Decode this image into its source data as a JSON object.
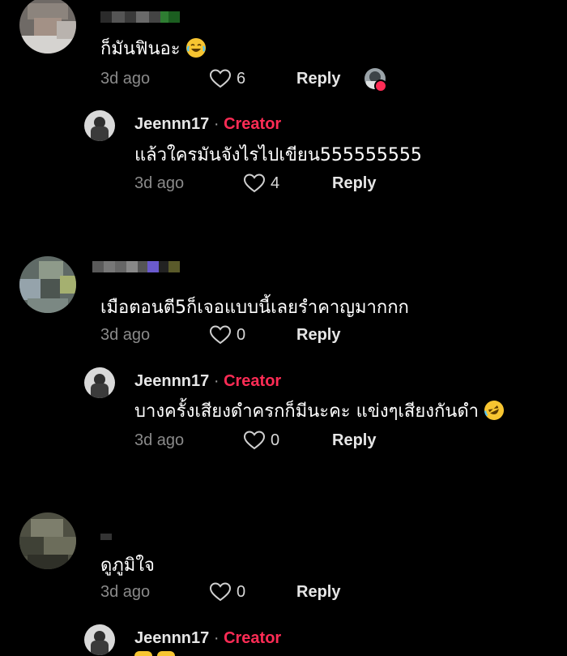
{
  "comments": [
    {
      "text": "ก็มันฟินอะ",
      "emoji_icon": "tears-of-joy-emoji",
      "time": "3d ago",
      "likes": "6",
      "reply_label": "Reply",
      "creator_liked": true,
      "reply": {
        "author": "Jeennn17",
        "separator": "·",
        "tag": "Creator",
        "text": "แล้วใครมันจังไรไปเขียน555555555",
        "time": "3d ago",
        "likes": "4",
        "reply_label": "Reply"
      }
    },
    {
      "text": "เมือตอนตี5ก็เจอแบบนี้เลยรำคาญมากกก",
      "time": "3d ago",
      "likes": "0",
      "reply_label": "Reply",
      "reply": {
        "author": "Jeennn17",
        "separator": "·",
        "tag": "Creator",
        "text": "บางครั้งเสียงดำครกก็มีนะคะ แข่งๆเสียงกันดำ",
        "emoji_icon": "rolling-laughing-emoji",
        "time": "3d ago",
        "likes": "0",
        "reply_label": "Reply"
      }
    },
    {
      "text": "ดูภูมิใจ",
      "time": "3d ago",
      "likes": "0",
      "reply_label": "Reply",
      "reply": {
        "author": "Jeennn17",
        "separator": "·",
        "tag": "Creator"
      }
    }
  ],
  "colors": {
    "background": "#000000",
    "creator_tag": "#fe2c55",
    "meta_text": "#8a8a8a"
  }
}
